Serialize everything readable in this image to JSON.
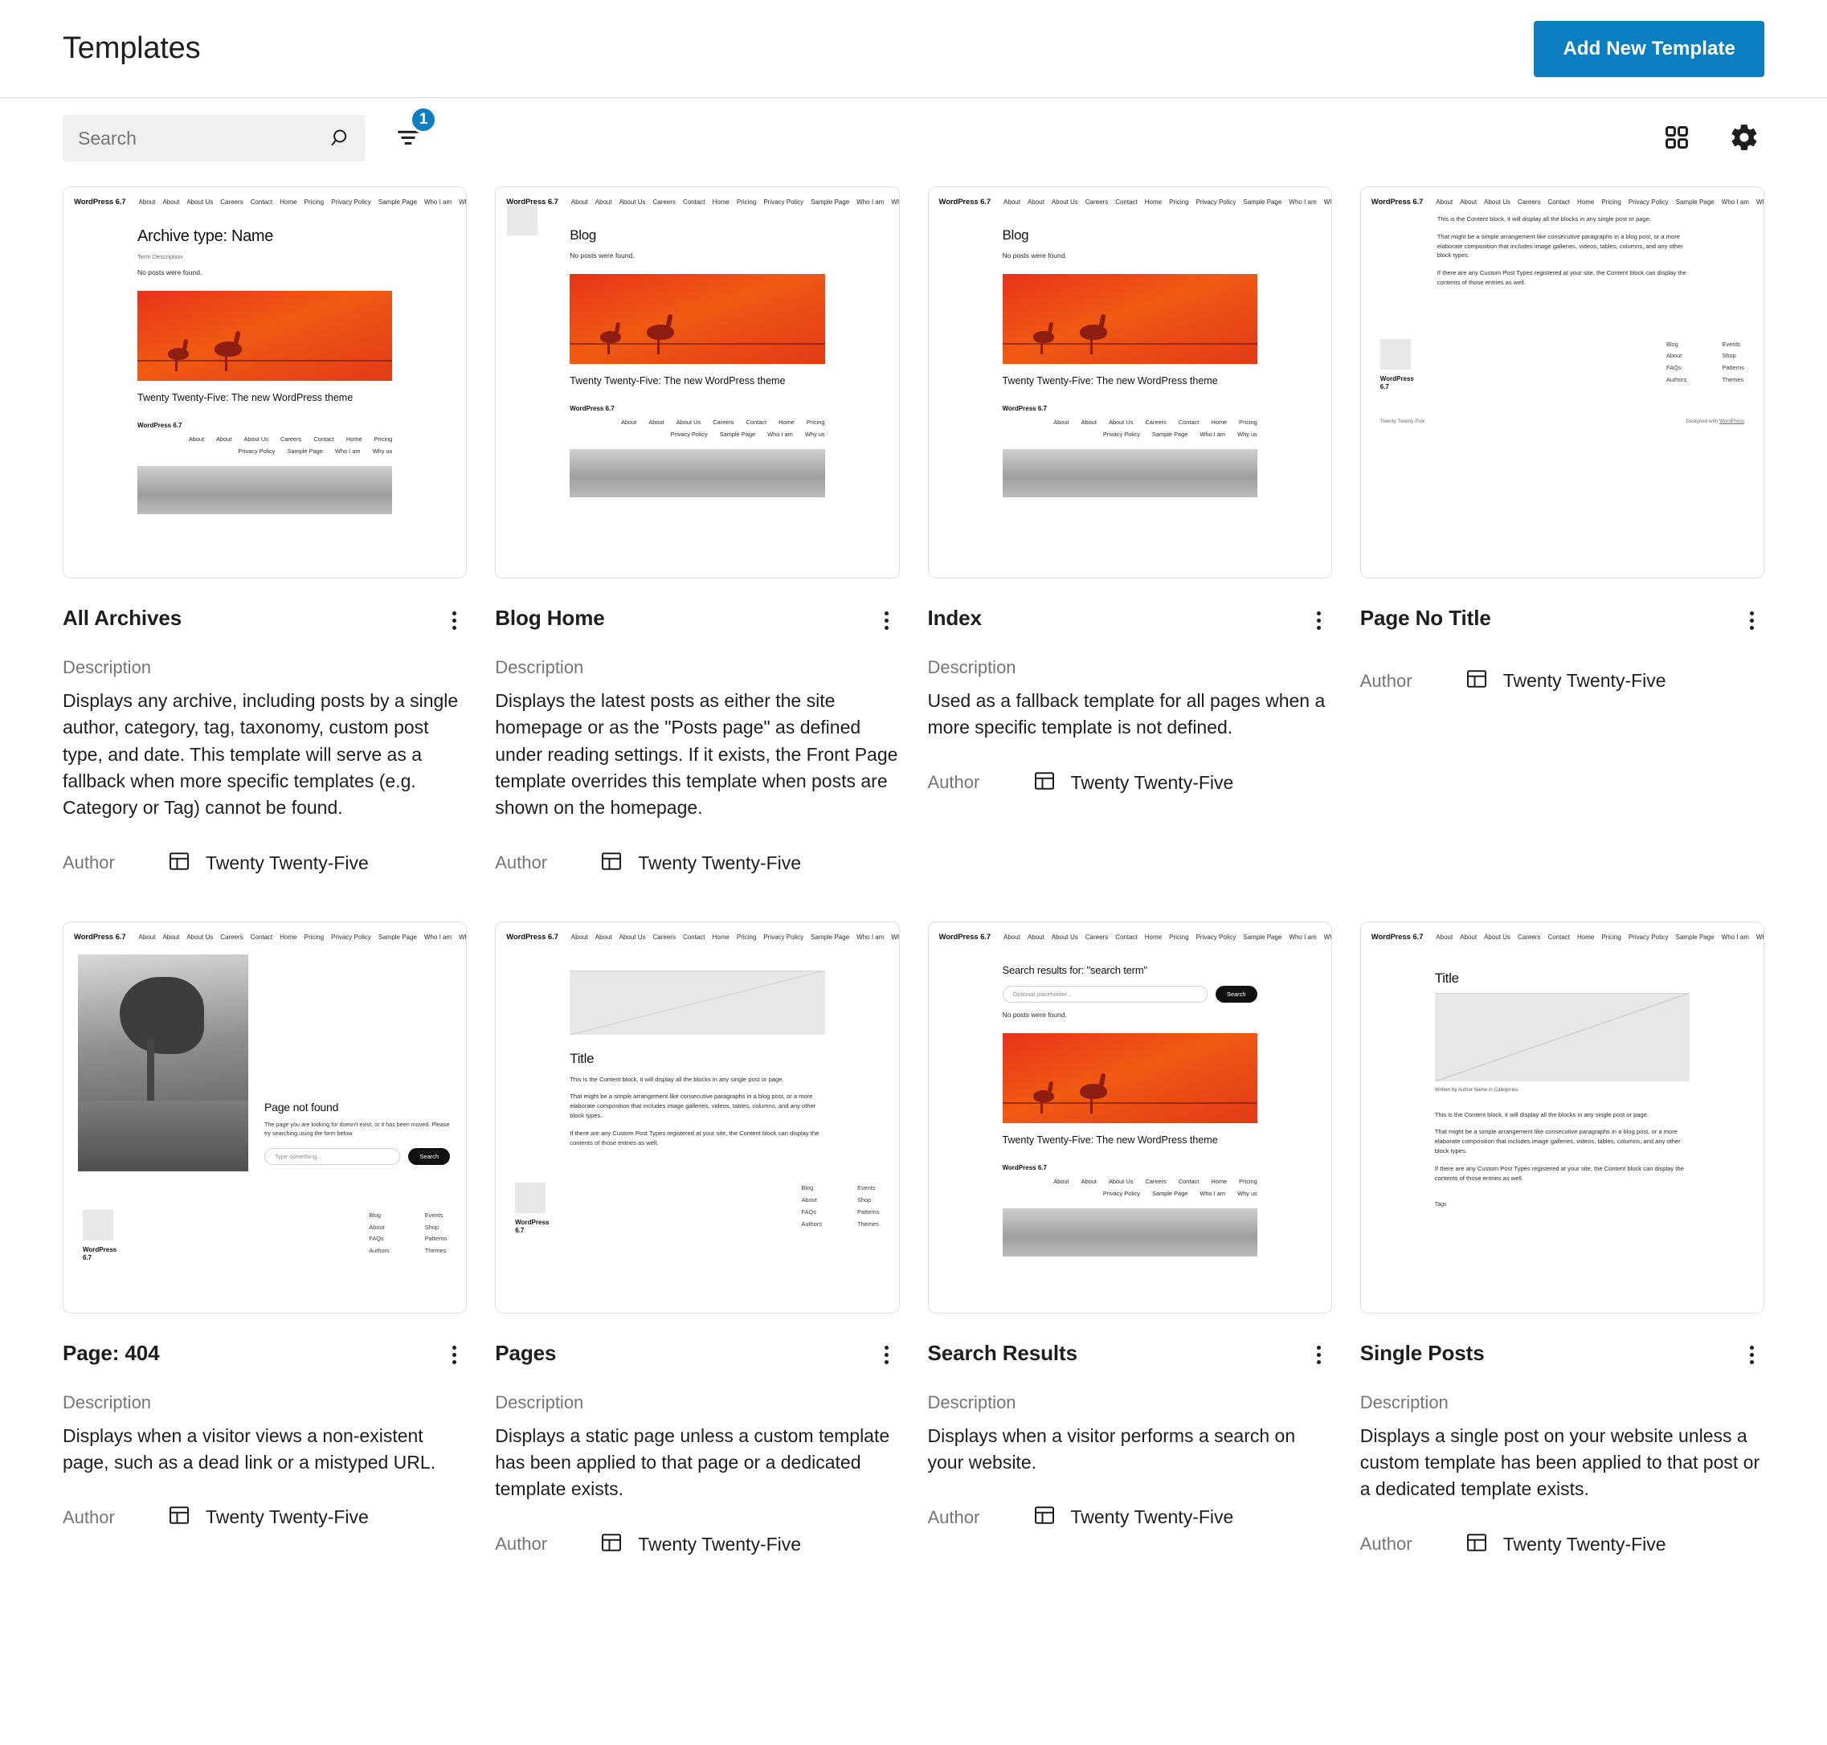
{
  "header": {
    "title": "Templates",
    "add_button": "Add New Template"
  },
  "toolbar": {
    "search_placeholder": "Search",
    "search_value": "",
    "filter_badge": "1",
    "icons": {
      "search": "search-icon",
      "filter": "filter-icon",
      "grid_view": "grid-view-icon",
      "settings": "gear-icon"
    }
  },
  "labels": {
    "description": "Description",
    "author": "Author"
  },
  "site_preview": {
    "brand": "WordPress 6.7",
    "nav": [
      "About",
      "About",
      "About Us",
      "Careers",
      "Contact",
      "Home",
      "Pricing",
      "Privacy Policy",
      "Sample Page",
      "Who I am",
      "Why us"
    ],
    "footer_nav_row1": [
      "About",
      "About",
      "About Us",
      "Careers",
      "Contact",
      "Home",
      "Pricing"
    ],
    "footer_nav_row2": [
      "Privacy Policy",
      "Sample Page",
      "Who I am",
      "Why us"
    ],
    "footer_col1": [
      "Blog",
      "About",
      "FAQs",
      "Authors"
    ],
    "footer_col2": [
      "Events",
      "Shop",
      "Patterns",
      "Themes"
    ],
    "footer_sitename": "WordPress 6.7",
    "footer_theme": "Twenty Twenty-Five",
    "designed_with": "Designed with",
    "designed_link": "WordPress",
    "hero_title": "Twenty Twenty-Five: The new WordPress theme",
    "content_p1": "This is the Content block, it will display all the blocks in any single post or page.",
    "content_p2": "That might be a simple arrangement like consecutive paragraphs in a blog post, or a more elaborate composition that includes image galleries, videos, tables, columns, and any other block types.",
    "content_p3": "If there are any Custom Post Types registered at your site, the Content block can display the contents of those entries as well.",
    "archive_heading": "Archive type: Name",
    "term_description": "Term Description",
    "no_posts": "No posts were found.",
    "blog_heading": "Blog",
    "title_heading": "Title",
    "not_found_heading": "Page not found",
    "not_found_body": "The page you are looking for doesn't exist, or it has been moved. Please try searching using the form below",
    "search_field_404": "Type something...",
    "search_btn": "Search",
    "search_results_heading": "Search results for: \"search term\"",
    "search_field_optional": "Optional placeholder...",
    "byline": "Written by Author Name in Categories"
  },
  "accent": {
    "primary": "#0b7fc0",
    "hero_start": "#e8331a",
    "hero_end": "#e23a18"
  },
  "templates": [
    {
      "name": "All Archives",
      "description": "Displays any archive, including posts by a single author, category, tag, taxonomy, custom post type, and date. This template will serve as a fallback when more specific templates (e.g. Category or Tag) cannot be found.",
      "author": "Twenty Twenty-Five",
      "has_description": true
    },
    {
      "name": "Blog Home",
      "description": "Displays the latest posts as either the site homepage or as the \"Posts page\" as defined under reading settings. If it exists, the Front Page template overrides this template when posts are shown on the homepage.",
      "author": "Twenty Twenty-Five",
      "has_description": true
    },
    {
      "name": "Index",
      "description": "Used as a fallback template for all pages when a more specific template is not defined.",
      "author": "Twenty Twenty-Five",
      "has_description": true
    },
    {
      "name": "Page No Title",
      "description": "",
      "author": "Twenty Twenty-Five",
      "has_description": false
    },
    {
      "name": "Page: 404",
      "description": "Displays when a visitor views a non-existent page, such as a dead link or a mistyped URL.",
      "author": "Twenty Twenty-Five",
      "has_description": true
    },
    {
      "name": "Pages",
      "description": "Displays a static page unless a custom template has been applied to that page or a dedicated template exists.",
      "author": "Twenty Twenty-Five",
      "has_description": true
    },
    {
      "name": "Search Results",
      "description": "Displays when a visitor performs a search on your website.",
      "author": "Twenty Twenty-Five",
      "has_description": true
    },
    {
      "name": "Single Posts",
      "description": "Displays a single post on your website unless a custom template has been applied to that post or a dedicated template exists.",
      "author": "Twenty Twenty-Five",
      "has_description": true
    }
  ]
}
